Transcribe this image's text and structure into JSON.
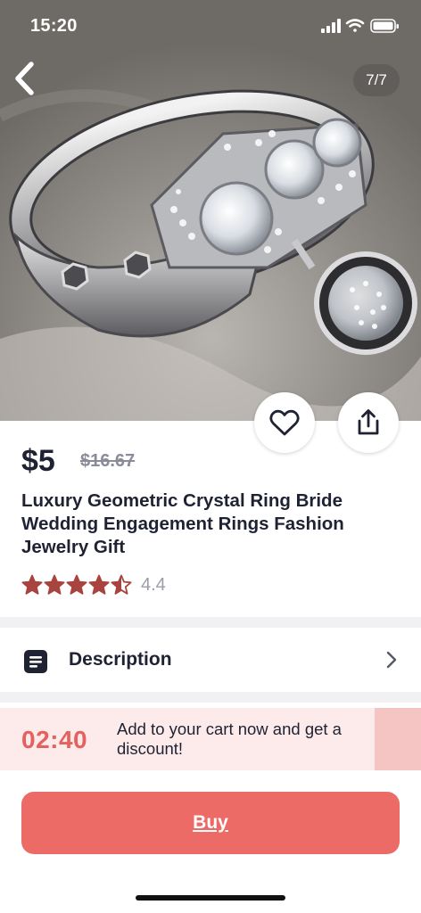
{
  "status_bar": {
    "time": "15:20"
  },
  "gallery": {
    "counter": "7/7"
  },
  "product": {
    "price": "$5",
    "original_price": "$16.67",
    "title": "Luxury Geometric Crystal Ring Bride Wedding Engagement Rings Fashion Jewelry Gift",
    "rating": "4.4",
    "rating_value": 4.4
  },
  "description": {
    "label": "Description"
  },
  "promo": {
    "timer": "02:40",
    "message": "Add to your cart now and get a discount!"
  },
  "buy": {
    "label": "Buy"
  },
  "colors": {
    "accent": "#ec6b66",
    "timer": "#e5615d",
    "banner_bg": "#fdebeb",
    "star": "#a8433f",
    "text": "#1f2233"
  },
  "icons": {
    "back": "chevron-left-icon",
    "favorite": "heart-icon",
    "share": "share-icon",
    "description": "document-icon",
    "row_chevron": "chevron-right-icon"
  }
}
